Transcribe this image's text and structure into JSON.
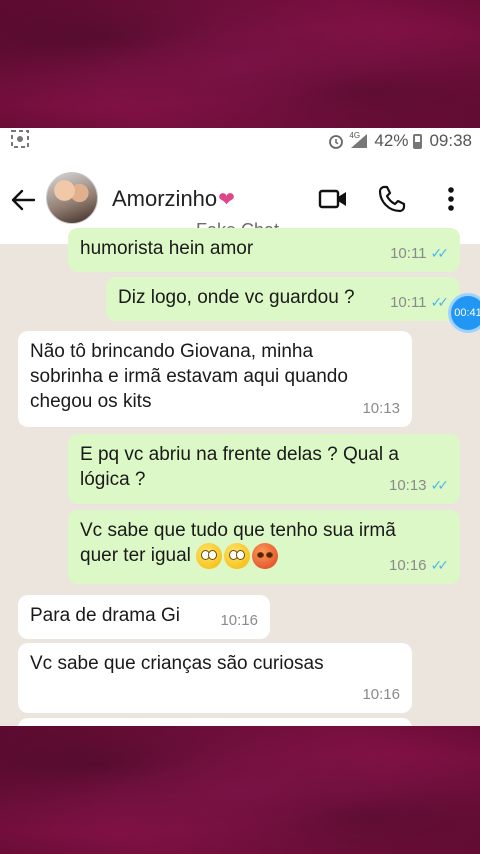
{
  "status_bar": {
    "battery": "42%",
    "time": "09:38",
    "network": "4G"
  },
  "header": {
    "contact_name": "Amorzinho",
    "heart": "❤",
    "overlay_label": "Fake Chat"
  },
  "messages": [
    {
      "direction": "out",
      "text": "humorista hein amor",
      "time": "10:11",
      "read": true
    },
    {
      "direction": "out",
      "text": "Diz logo, onde vc guardou ?",
      "time": "10:11",
      "read": true
    },
    {
      "direction": "in",
      "text_lines": [
        "Não tô brincando Giovana, minha",
        "sobrinha e irmã estavam aqui quando",
        "chegou os kits"
      ],
      "time": "10:13"
    },
    {
      "direction": "out",
      "text_lines": [
        "E pq vc abriu na frente delas ? Qual a",
        "lógica ?"
      ],
      "time": "10:13",
      "read": true
    },
    {
      "direction": "out",
      "text_lines": [
        "Vc sabe que tudo que tenho sua irmã",
        "quer ter igual"
      ],
      "emojis": [
        "rolling-eyes",
        "rolling-eyes",
        "angry-face"
      ],
      "time": "10:16",
      "read": true
    },
    {
      "direction": "in",
      "text": "Para de drama Gi",
      "time": "10:16"
    },
    {
      "direction": "in",
      "text": "Vc sabe que crianças são curiosas",
      "time": "10:16"
    }
  ],
  "timer_badge": "00:41",
  "colors": {
    "outgoing_bubble": "#dcf8c6",
    "incoming_bubble": "#ffffff",
    "chat_bg": "#ece5dd",
    "read_ticks": "#4fb6ec",
    "frame": "#7a0f3f"
  }
}
